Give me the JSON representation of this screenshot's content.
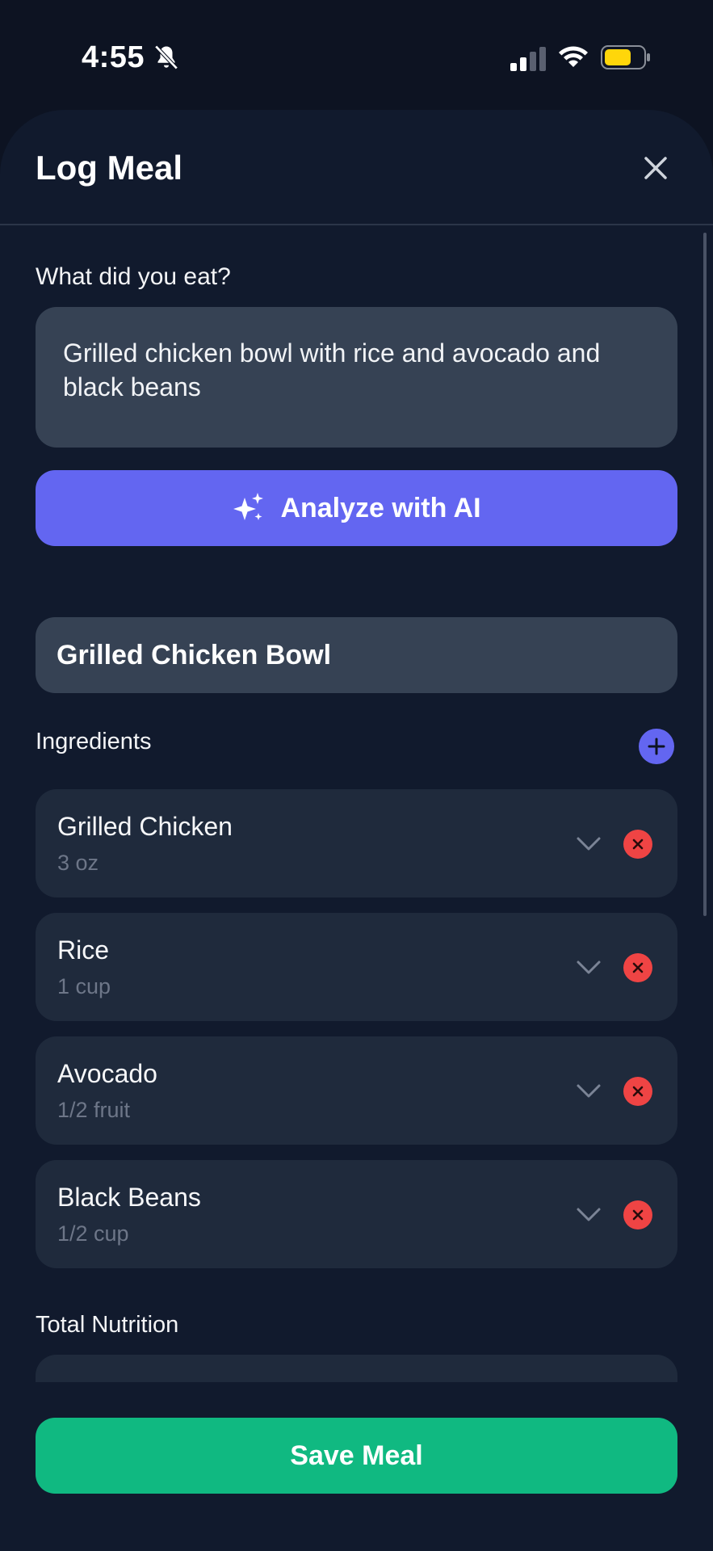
{
  "status_bar": {
    "time": "4:55",
    "icons": [
      "bell-slash-icon",
      "cellular-signal-icon",
      "wifi-icon",
      "battery-icon"
    ],
    "battery_color": "#ffd60a"
  },
  "header": {
    "title": "Log Meal",
    "close_icon": "close-icon"
  },
  "form": {
    "question": "What did you eat?",
    "description": "Grilled chicken bowl with rice and avocado and black beans",
    "analyze_label": "Analyze with AI",
    "analyze_icon": "sparkles-icon",
    "meal_name": "Grilled Chicken Bowl"
  },
  "ingredients": {
    "label": "Ingredients",
    "add_icon": "plus-icon",
    "items": [
      {
        "name": "Grilled Chicken",
        "quantity": "3 oz"
      },
      {
        "name": "Rice",
        "quantity": "1 cup"
      },
      {
        "name": "Avocado",
        "quantity": "1/2 fruit"
      },
      {
        "name": "Black Beans",
        "quantity": "1/2 cup"
      }
    ]
  },
  "nutrition": {
    "label": "Total Nutrition"
  },
  "footer": {
    "save_label": "Save Meal"
  },
  "colors": {
    "accent": "#6366f1",
    "save": "#10b981",
    "danger": "#ef4444",
    "background": "#111a2d",
    "card": "#1f2a3c",
    "input": "#364254"
  }
}
